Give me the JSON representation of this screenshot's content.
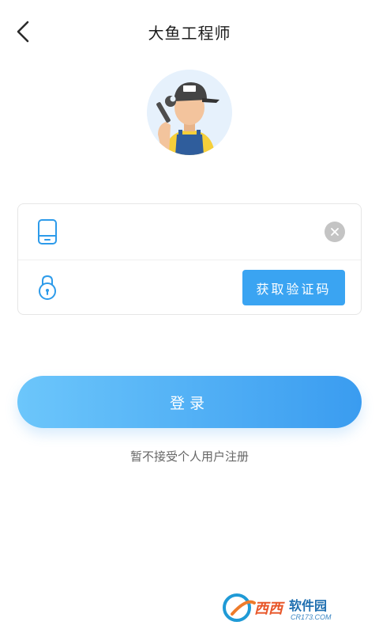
{
  "header": {
    "title": "大鱼工程师"
  },
  "login_form": {
    "phone_placeholder": "",
    "code_placeholder": "",
    "get_code_label": "获取验证码"
  },
  "login_button": {
    "label": "登录"
  },
  "notice": "暂不接受个人用户注册",
  "watermark": {
    "brand": "西西软件园",
    "url": "CR173.COM"
  },
  "icons": {
    "back": "chevron-left-icon",
    "phone": "phone-icon",
    "lock": "lock-icon",
    "clear": "clear-icon"
  },
  "colors": {
    "accent": "#3aa4f2",
    "gradient_start": "#6cc6fb",
    "gradient_end": "#3a9cf0",
    "text": "#1c1c1c"
  }
}
